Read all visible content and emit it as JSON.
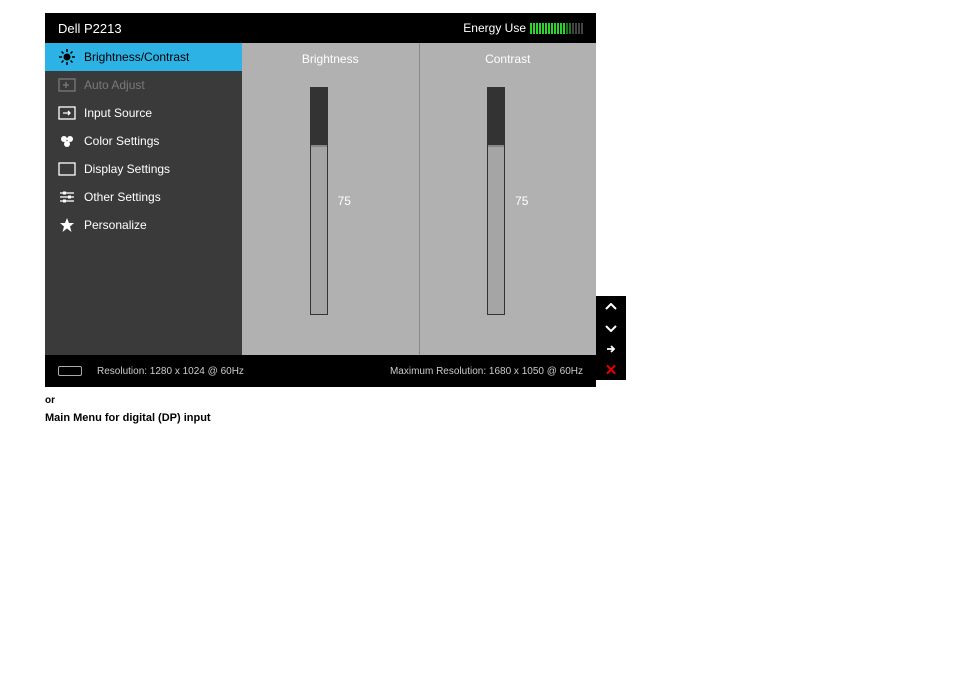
{
  "header": {
    "title": "Dell P2213",
    "energy_label": "Energy Use"
  },
  "menu": {
    "items": [
      {
        "label": "Brightness/Contrast",
        "selected": true,
        "disabled": false
      },
      {
        "label": "Auto Adjust",
        "selected": false,
        "disabled": true
      },
      {
        "label": "Input Source",
        "selected": false,
        "disabled": false
      },
      {
        "label": "Color Settings",
        "selected": false,
        "disabled": false
      },
      {
        "label": "Display Settings",
        "selected": false,
        "disabled": false
      },
      {
        "label": "Other Settings",
        "selected": false,
        "disabled": false
      },
      {
        "label": "Personalize",
        "selected": false,
        "disabled": false
      }
    ]
  },
  "panels": {
    "brightness": {
      "label": "Brightness",
      "value": "75",
      "percent": 75
    },
    "contrast": {
      "label": "Contrast",
      "value": "75",
      "percent": 75
    }
  },
  "footer": {
    "resolution": "Resolution: 1280 x 1024 @ 60Hz",
    "max_resolution": "Maximum Resolution: 1680 x 1050 @ 60Hz"
  },
  "captions": {
    "or": "or",
    "subtitle": "Main Menu for digital (DP) input"
  }
}
